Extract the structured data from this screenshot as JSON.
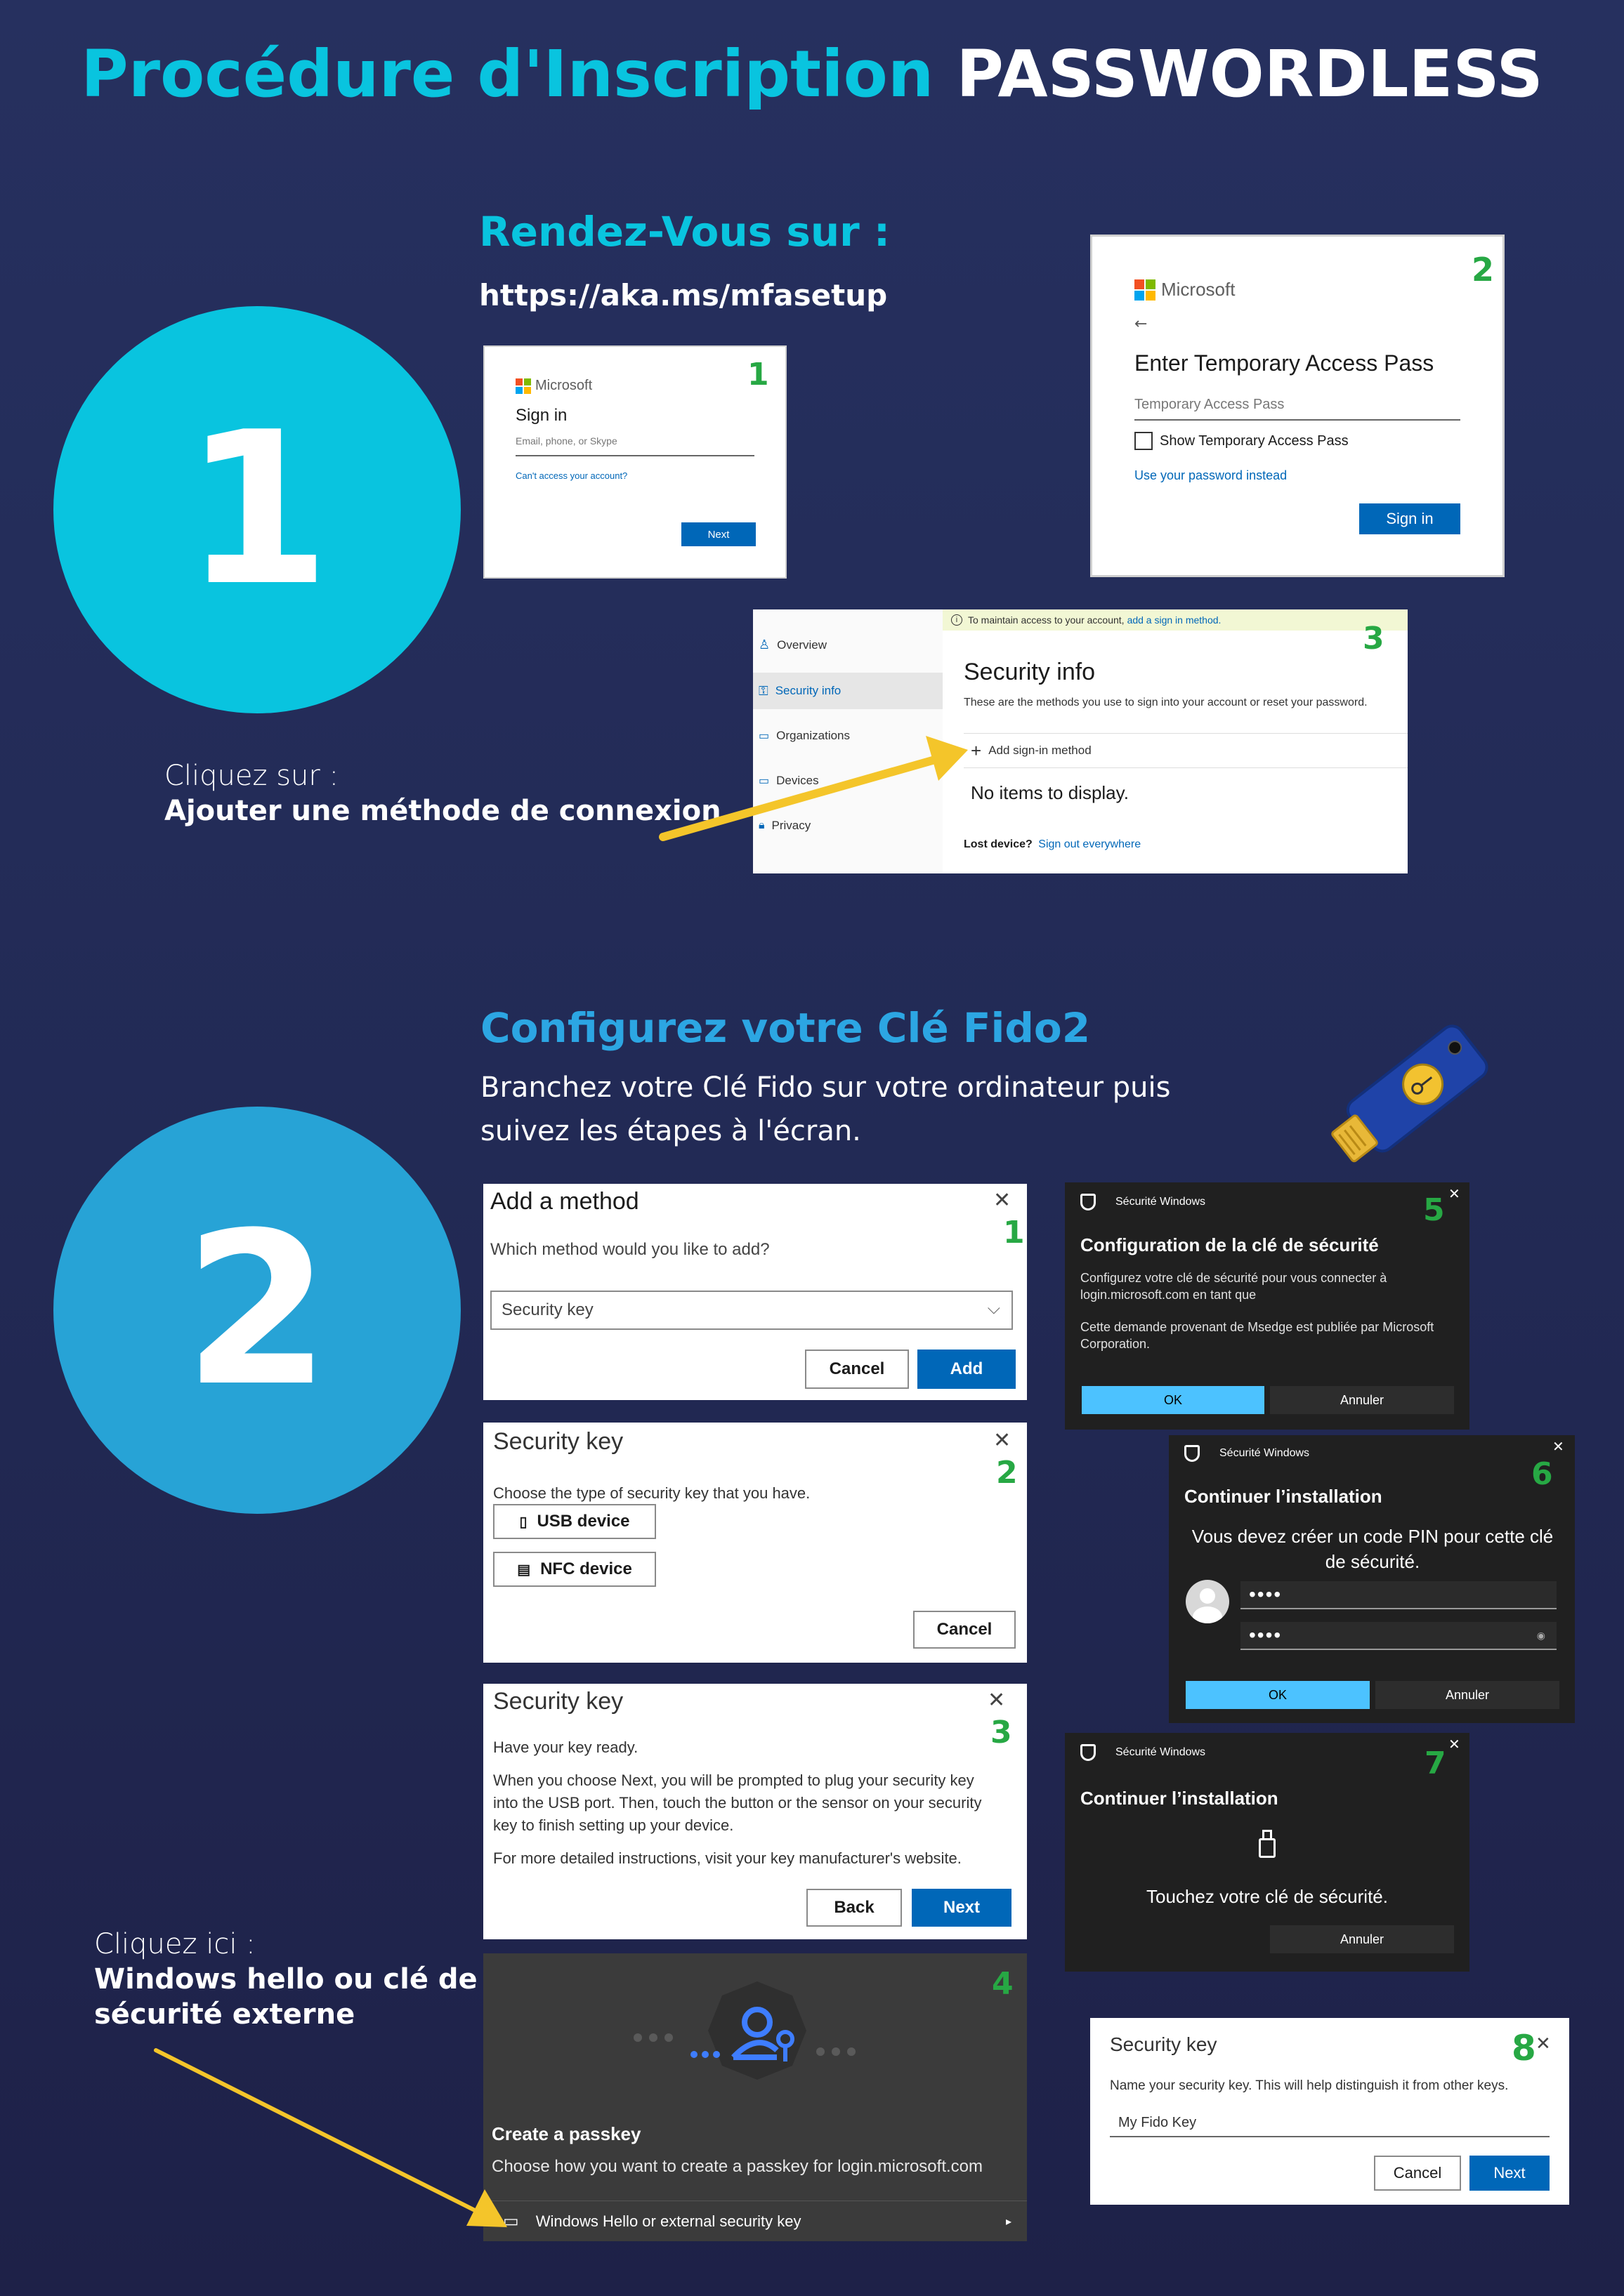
{
  "header": {
    "title_part1": "Procédure d'Inscription ",
    "title_part2": "PASSWORDLESS"
  },
  "step1": {
    "number": "1",
    "heading": "Rendez-Vous sur :",
    "url": "https://aka.ms/mfasetup",
    "instruction_line1": "Cliquez sur :",
    "instruction_line2": "Ajouter une méthode de connexion",
    "signin": {
      "badge": "1",
      "brand": "Microsoft",
      "title": "Sign in",
      "placeholder": "Email, phone, or Skype",
      "link": "Can't access your account?",
      "next": "Next"
    },
    "tap": {
      "badge": "2",
      "brand": "Microsoft",
      "back": "←",
      "title": "Enter Temporary Access Pass",
      "placeholder": "Temporary Access Pass",
      "checkbox": "Show Temporary Access Pass",
      "link": "Use your password instead",
      "signin": "Sign in"
    },
    "security_info": {
      "badge": "3",
      "banner_prefix": "To maintain access to your account, ",
      "banner_link": "add a sign in method.",
      "nav": [
        "Overview",
        "Security info",
        "Organizations",
        "Devices",
        "Privacy"
      ],
      "title": "Security info",
      "subtitle": "These are the methods you use to sign into your account or reset your password.",
      "add_method": "Add sign-in method",
      "empty": "No items to display.",
      "lost_device": "Lost device?",
      "sign_out": "Sign out everywhere"
    }
  },
  "step2": {
    "number": "2",
    "heading": "Configurez votre Clé Fido2",
    "desc_line1": "Branchez votre Clé Fido sur votre ordinateur puis",
    "desc_line2": "suivez les étapes à l'écran.",
    "instruction_line1": "Cliquez ici :",
    "instruction_line2": "Windows hello ou clé de",
    "instruction_line3": "sécurité externe",
    "add_method": {
      "badge": "1",
      "title": "Add a method",
      "question": "Which method would you like to add?",
      "selected": "Security key",
      "cancel": "Cancel",
      "add": "Add"
    },
    "key_type": {
      "badge": "2",
      "title": "Security key",
      "prompt": "Choose the type of security key that you have.",
      "usb": "USB device",
      "nfc": "NFC device",
      "cancel": "Cancel"
    },
    "key_ready": {
      "badge": "3",
      "title": "Security key",
      "p1": "Have your key ready.",
      "p2": "When you choose Next, you will be prompted to plug your security key into the USB port. Then, touch the button or the sensor on your security key to finish setting up your device.",
      "p3": "For more detailed instructions, visit your key manufacturer's website.",
      "back": "Back",
      "next": "Next"
    },
    "passkey": {
      "badge": "4",
      "title": "Create a passkey",
      "subtitle": "Choose how you want to create a passkey for login.microsoft.com",
      "option": "Windows Hello or external security key"
    },
    "win5": {
      "badge": "5",
      "app": "Sécurité Windows",
      "title": "Configuration de la clé de sécurité",
      "p1": "Configurez votre clé de sécurité pour vous connecter à login.microsoft.com en tant que",
      "p2": "Cette demande provenant de Msedge est publiée par Microsoft Corporation.",
      "ok": "OK",
      "cancel": "Annuler"
    },
    "win6": {
      "badge": "6",
      "app": "Sécurité Windows",
      "title": "Continuer l’installation",
      "message": "Vous devez créer un code PIN pour cette clé de sécurité.",
      "pin1": "••••",
      "pin2": "••••",
      "ok": "OK",
      "cancel": "Annuler"
    },
    "win7": {
      "badge": "7",
      "app": "Sécurité Windows",
      "title": "Continuer l’installation",
      "message": "Touchez votre clé de sécurité.",
      "cancel": "Annuler"
    },
    "name_key": {
      "badge": "8",
      "title": "Security key",
      "prompt": "Name your security key. This will help distinguish it from other keys.",
      "value": "My Fido Key",
      "cancel": "Cancel",
      "next": "Next"
    }
  },
  "colors": {
    "background": "#232a57",
    "cyan": "#09c4df",
    "circle2": "#27a3d6",
    "heading2": "#2ca6e3",
    "arrow": "#f4c52a",
    "badge_green": "#27a844",
    "ms_blue": "#0067b8",
    "win_blue": "#4cc2ff"
  }
}
